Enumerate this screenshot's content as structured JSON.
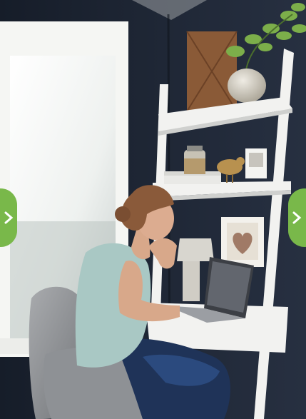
{
  "colors": {
    "accent": "#79b84a",
    "wall": "#1f2735",
    "shelf": "#f2f2f0"
  },
  "controls": {
    "prev_icon": "chevron-right-icon",
    "next_icon": "chevron-right-icon"
  }
}
